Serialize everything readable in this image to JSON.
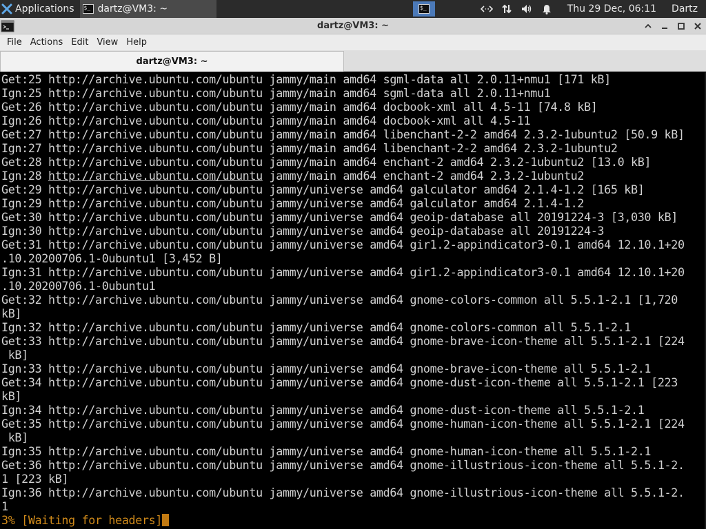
{
  "panel": {
    "applications_label": "Applications",
    "task_label": "dartz@VM3: ~",
    "clock": "Thu 29 Dec, 06:11",
    "user": "Dartz",
    "tray_icons": [
      "code-icon",
      "network-icon",
      "volume-icon",
      "bell-icon"
    ]
  },
  "window": {
    "title": "dartz@VM3: ~",
    "buttons": [
      "minimize",
      "maximize",
      "close"
    ]
  },
  "menu": {
    "file": "File",
    "actions": "Actions",
    "edit": "Edit",
    "view": "View",
    "help": "Help"
  },
  "tabs": [
    {
      "label": "dartz@VM3: ~",
      "active": true
    }
  ],
  "terminal": {
    "lines": [
      "Get:25 http://archive.ubuntu.com/ubuntu jammy/main amd64 sgml-data all 2.0.11+nmu1 [171 kB]",
      "Ign:25 http://archive.ubuntu.com/ubuntu jammy/main amd64 sgml-data all 2.0.11+nmu1",
      "Get:26 http://archive.ubuntu.com/ubuntu jammy/main amd64 docbook-xml all 4.5-11 [74.8 kB]",
      "Ign:26 http://archive.ubuntu.com/ubuntu jammy/main amd64 docbook-xml all 4.5-11",
      "Get:27 http://archive.ubuntu.com/ubuntu jammy/main amd64 libenchant-2-2 amd64 2.3.2-1ubuntu2 [50.9 kB]",
      "Ign:27 http://archive.ubuntu.com/ubuntu jammy/main amd64 libenchant-2-2 amd64 2.3.2-1ubuntu2",
      "Get:28 http://archive.ubuntu.com/ubuntu jammy/main amd64 enchant-2 amd64 2.3.2-1ubuntu2 [13.0 kB]",
      "Ign:28 http://archive.ubuntu.com/ubuntu jammy/main amd64 enchant-2 amd64 2.3.2-1ubuntu2",
      "Get:29 http://archive.ubuntu.com/ubuntu jammy/universe amd64 galculator amd64 2.1.4-1.2 [165 kB]",
      "Ign:29 http://archive.ubuntu.com/ubuntu jammy/universe amd64 galculator amd64 2.1.4-1.2",
      "Get:30 http://archive.ubuntu.com/ubuntu jammy/universe amd64 geoip-database all 20191224-3 [3,030 kB]",
      "Ign:30 http://archive.ubuntu.com/ubuntu jammy/universe amd64 geoip-database all 20191224-3",
      "Get:31 http://archive.ubuntu.com/ubuntu jammy/universe amd64 gir1.2-appindicator3-0.1 amd64 12.10.1+20",
      ".10.20200706.1-0ubuntu1 [3,452 B]",
      "Ign:31 http://archive.ubuntu.com/ubuntu jammy/universe amd64 gir1.2-appindicator3-0.1 amd64 12.10.1+20",
      ".10.20200706.1-0ubuntu1",
      "Get:32 http://archive.ubuntu.com/ubuntu jammy/universe amd64 gnome-colors-common all 5.5.1-2.1 [1,720",
      "kB]",
      "Ign:32 http://archive.ubuntu.com/ubuntu jammy/universe amd64 gnome-colors-common all 5.5.1-2.1",
      "Get:33 http://archive.ubuntu.com/ubuntu jammy/universe amd64 gnome-brave-icon-theme all 5.5.1-2.1 [224",
      " kB]",
      "Ign:33 http://archive.ubuntu.com/ubuntu jammy/universe amd64 gnome-brave-icon-theme all 5.5.1-2.1",
      "Get:34 http://archive.ubuntu.com/ubuntu jammy/universe amd64 gnome-dust-icon-theme all 5.5.1-2.1 [223",
      "kB]",
      "Ign:34 http://archive.ubuntu.com/ubuntu jammy/universe amd64 gnome-dust-icon-theme all 5.5.1-2.1",
      "Get:35 http://archive.ubuntu.com/ubuntu jammy/universe amd64 gnome-human-icon-theme all 5.5.1-2.1 [224",
      " kB]",
      "Ign:35 http://archive.ubuntu.com/ubuntu jammy/universe amd64 gnome-human-icon-theme all 5.5.1-2.1",
      "Get:36 http://archive.ubuntu.com/ubuntu jammy/universe amd64 gnome-illustrious-icon-theme all 5.5.1-2.",
      "1 [223 kB]",
      "Ign:36 http://archive.ubuntu.com/ubuntu jammy/universe amd64 gnome-illustrious-icon-theme all 5.5.1-2.",
      "1"
    ],
    "underlined_line_index": 7,
    "underlined_text": "http://archive.ubuntu.com/ubuntu",
    "progress": "3% [Waiting for headers]"
  },
  "colors": {
    "panel_bg": "#2b2b2b",
    "workspace_active": "#4b79b8",
    "terminal_bg": "#000000",
    "terminal_fg": "#d0d0d0",
    "progress_fg": "#d08a1a"
  }
}
